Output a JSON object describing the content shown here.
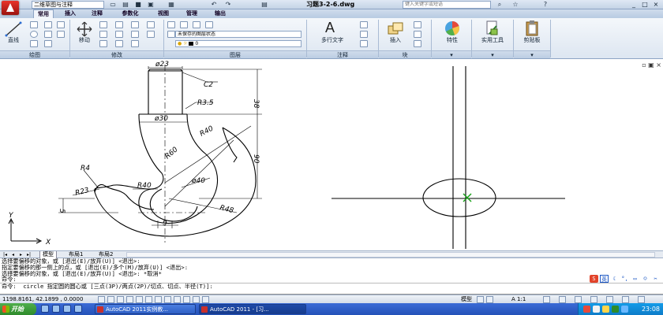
{
  "titlebar": {
    "workspace": "二维草图与注释",
    "document_title": "习题3-2-6.dwg",
    "search_placeholder": "键入关键字或短语",
    "win_controls": [
      "_",
      "□",
      "×"
    ]
  },
  "ribbon_tabs": [
    "常用",
    "插入",
    "注释",
    "参数化",
    "视图",
    "管理",
    "输出"
  ],
  "ribbon": {
    "draw": {
      "line_label": "直线",
      "panel_label": "绘图"
    },
    "modify": {
      "move_label": "移动",
      "panel_label": "修改"
    },
    "layers": {
      "state": "未保存的图层状态",
      "current": "0",
      "panel_label": "图层"
    },
    "annotation": {
      "mtext_label": "多行文字",
      "panel_label": "注释"
    },
    "block": {
      "insert_label": "插入",
      "panel_label": "块"
    },
    "properties": {
      "label": "特性"
    },
    "utilities": {
      "label": "实用工具"
    },
    "clipboard": {
      "label": "剪贴板"
    }
  },
  "drawing_dims": {
    "d23": "ø23",
    "c2": "C2",
    "r35": "R3.5",
    "d30": "ø30",
    "d40": "ø40",
    "r40a": "R40",
    "r40b": "R40",
    "r60": "R60",
    "r4": "R4",
    "r23": "R23",
    "r48": "R48",
    "v38": "38",
    "v90": "90",
    "v5": "5",
    "h9": "9"
  },
  "ucs": {
    "y": "Y",
    "x": "X"
  },
  "layout_tabs": [
    "模型",
    "布局1",
    "布局2"
  ],
  "command_lines": [
    "选择要偏移的对象，或 [退出(E)/放弃(U)] <退出>:",
    "指定要偏移的那一侧上的点，或 [退出(E)/多个(M)/放弃(U)] <退出>:",
    "选择要偏移的对象，或 [退出(E)/放弃(U)] <退出>: *取消*",
    "命令:",
    "命令: _circle 指定圆的圆心或 [三点(3P)/两点(2P)/切点、切点、半径(T)]:"
  ],
  "ime": {
    "label": "英"
  },
  "status": {
    "coords": "1198.8161, 42.1899 , 0.0000",
    "model": "模型",
    "scale": "A 1:1"
  },
  "taskbar": {
    "start": "开始",
    "items": [
      "AutoCAD 2011实例教...",
      "AutoCAD 2011 - [习..."
    ],
    "clock": "23:08"
  }
}
